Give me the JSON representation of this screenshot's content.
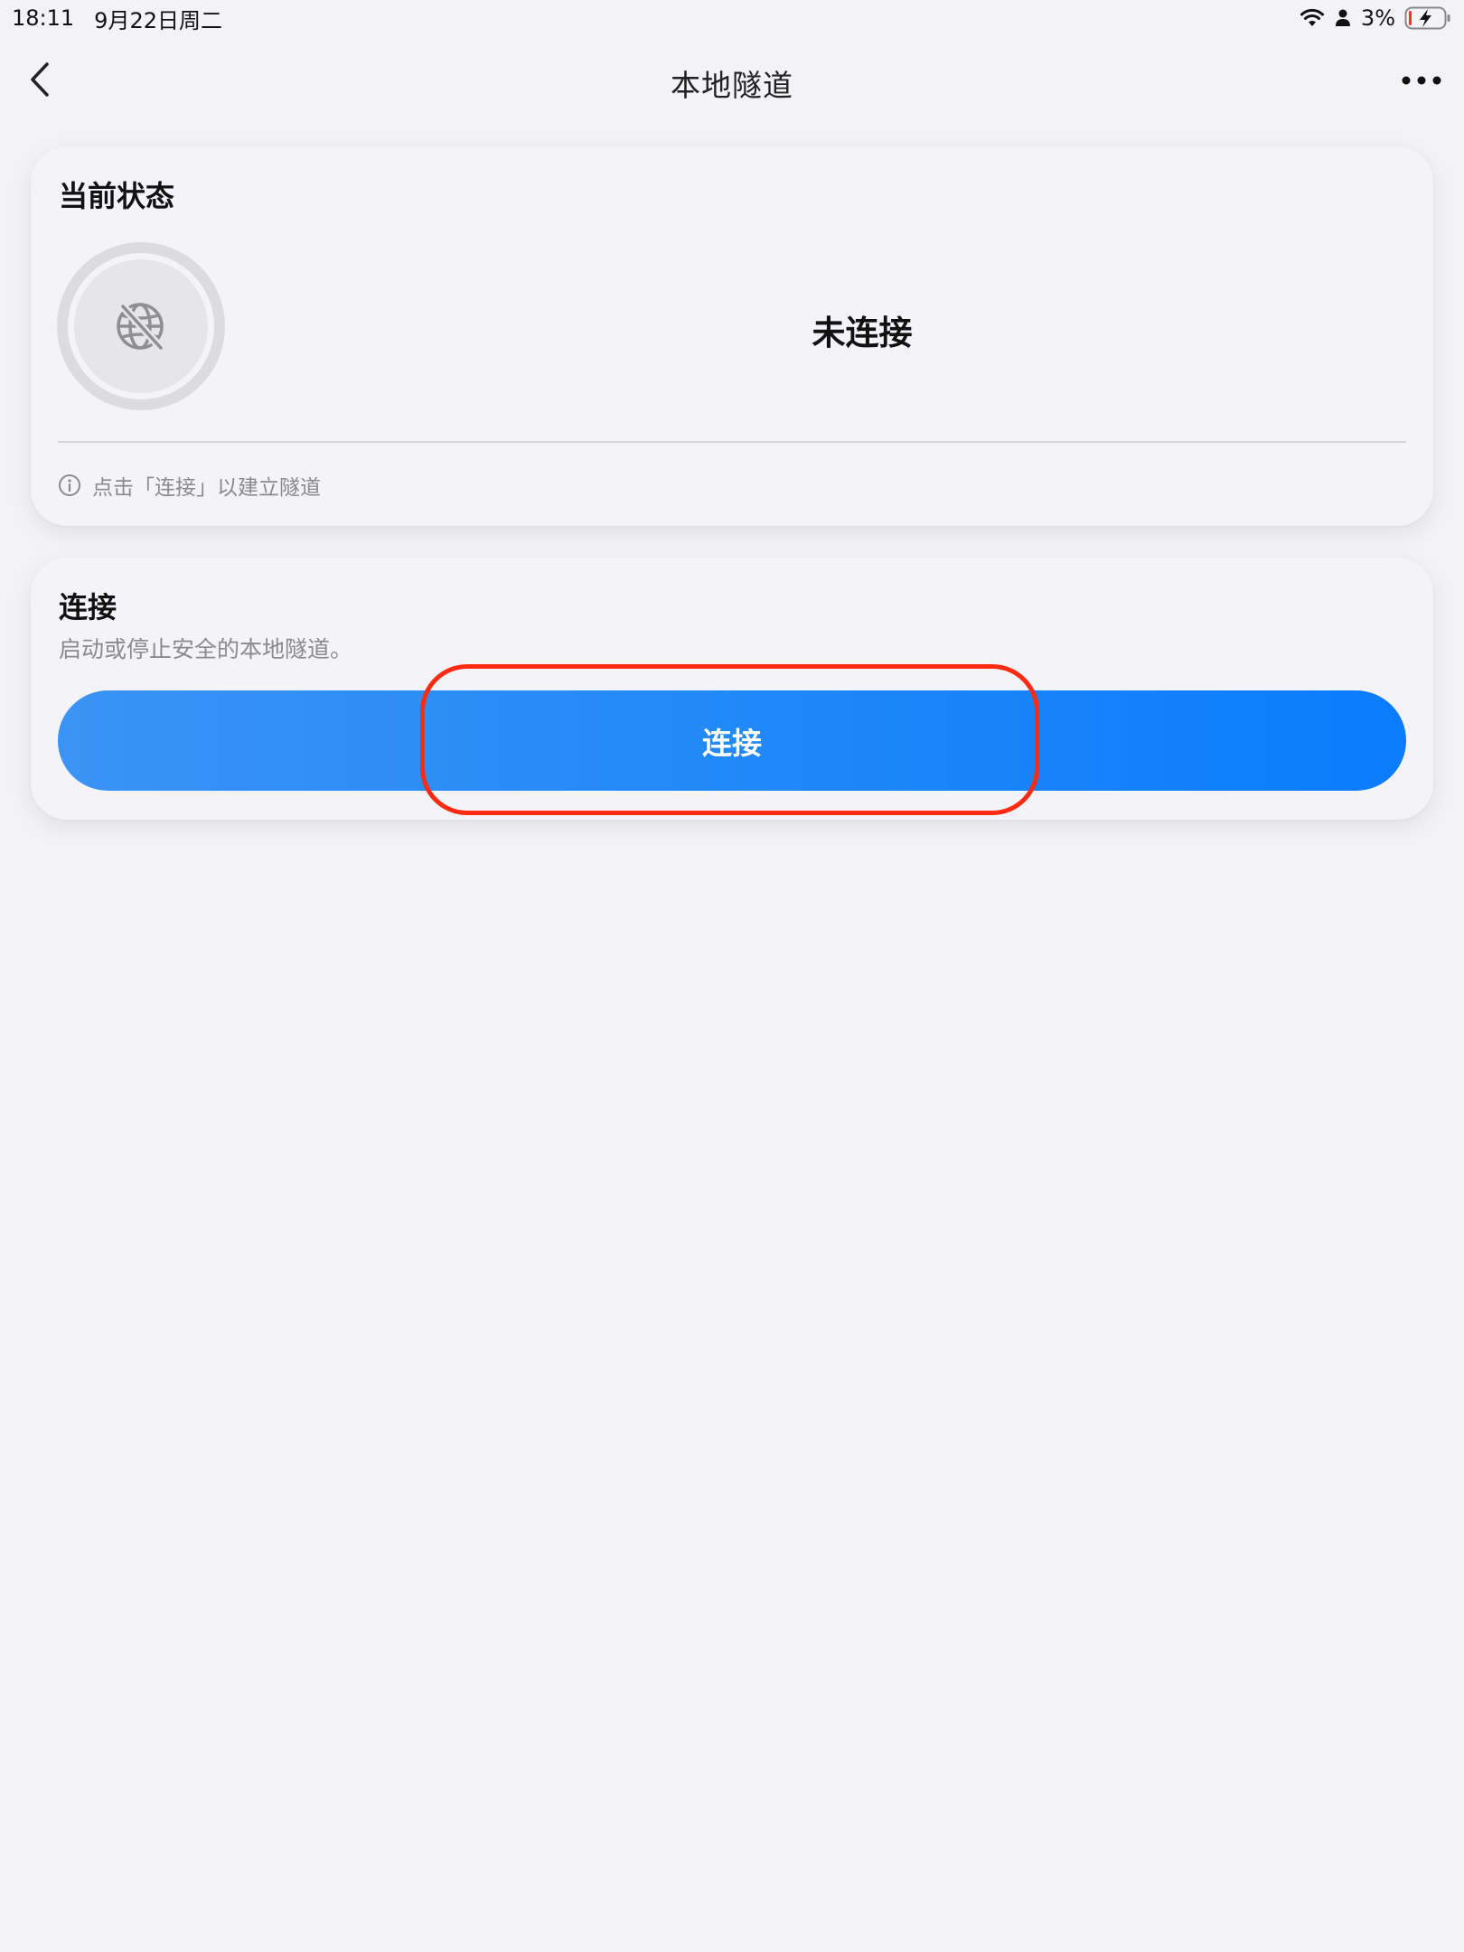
{
  "status_bar": {
    "time": "18:11",
    "date": "9月22日周二",
    "battery_percent": "3%",
    "icons": [
      "wifi-icon",
      "person-icon",
      "battery-charging-icon"
    ]
  },
  "nav": {
    "title": "本地隧道",
    "back_icon": "chevron-left-icon",
    "more_icon": "ellipsis-icon"
  },
  "status_card": {
    "title": "当前状态",
    "status": "未连接",
    "status_icon": "globe-slash-icon",
    "hint": "点击「连接」以建立隧道",
    "hint_icon": "info-icon"
  },
  "connect_card": {
    "title": "连接",
    "subtitle": "启动或停止安全的本地隧道。",
    "button_label": "连接"
  },
  "colors": {
    "accent": "#0a7cfc",
    "highlight": "#ff2a12",
    "background": "#f3f3f7"
  }
}
